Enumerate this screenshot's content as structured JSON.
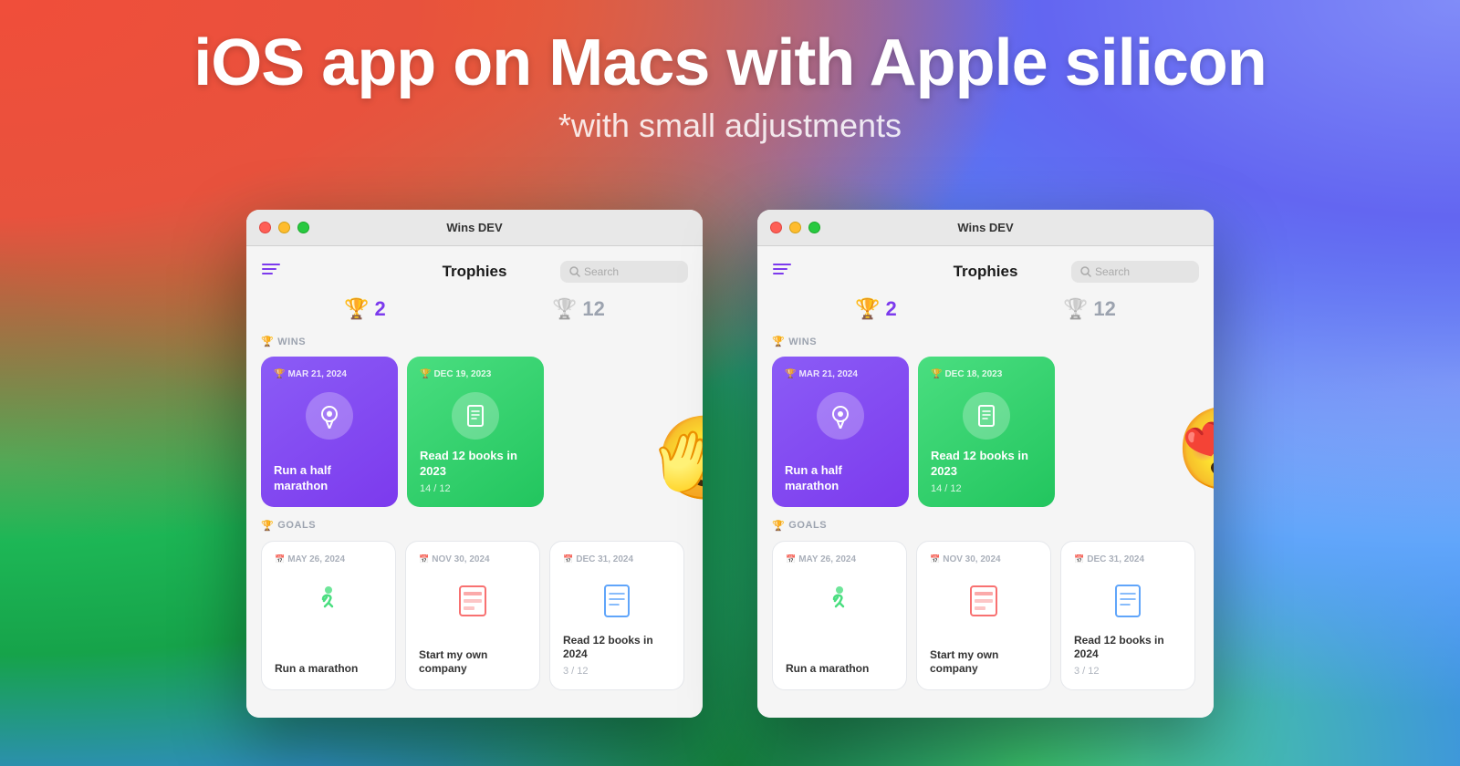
{
  "hero": {
    "title": "iOS app on Macs with Apple silicon",
    "subtitle": "*with small adjustments"
  },
  "window_left": {
    "title": "Wins DEV",
    "traffic_lights": [
      "red",
      "yellow",
      "green"
    ],
    "filter_icon": "≡",
    "section_header": "Trophies",
    "search_placeholder": "Search",
    "trophy_counts": [
      {
        "color": "purple",
        "value": "2"
      },
      {
        "color": "gray",
        "value": "12"
      }
    ],
    "wins_section": {
      "label": "WINS",
      "cards": [
        {
          "type": "purple",
          "date": "MAR 21, 2024",
          "icon": "medal",
          "name": "Run a half marathon",
          "progress": null
        },
        {
          "type": "green",
          "date": "DEC 19, 2023",
          "icon": "book",
          "name": "Read 12 books in 2023",
          "progress": "14 / 12"
        }
      ]
    },
    "goals_section": {
      "label": "GOALS",
      "cards": [
        {
          "type": "white",
          "date": "MAY 26, 2024",
          "icon": "runner",
          "icon_color": "green",
          "name": "Run a marathon",
          "progress": null
        },
        {
          "type": "white",
          "date": "NOV 30, 2024",
          "icon": "building",
          "icon_color": "red",
          "name": "Start my own company",
          "progress": null
        },
        {
          "type": "white",
          "date": "DEC 31, 2024",
          "icon": "book",
          "icon_color": "blue",
          "name": "Read 12 books in 2024",
          "progress": "3 / 12"
        }
      ]
    },
    "emoji": "🫣"
  },
  "window_right": {
    "title": "Wins DEV",
    "traffic_lights": [
      "red",
      "yellow",
      "green"
    ],
    "filter_icon": "≡",
    "section_header": "Trophies",
    "search_placeholder": "Search",
    "trophy_counts": [
      {
        "color": "purple",
        "value": "2"
      },
      {
        "color": "gray",
        "value": "12"
      }
    ],
    "wins_section": {
      "label": "WINS",
      "cards": [
        {
          "type": "purple",
          "date": "MAR 21, 2024",
          "icon": "medal",
          "name": "Run a half marathon",
          "progress": null
        },
        {
          "type": "green",
          "date": "DEC 18, 2023",
          "icon": "book",
          "name": "Read 12 books in 2023",
          "progress": "14 / 12"
        }
      ]
    },
    "goals_section": {
      "label": "GOALS",
      "cards": [
        {
          "type": "white",
          "date": "MAY 26, 2024",
          "icon": "runner",
          "icon_color": "green",
          "name": "Run a marathon",
          "progress": null
        },
        {
          "type": "white",
          "date": "NOV 30, 2024",
          "icon": "building",
          "icon_color": "red",
          "name": "Start my own company",
          "progress": null
        },
        {
          "type": "white",
          "date": "DEC 31, 2024",
          "icon": "book",
          "icon_color": "blue",
          "name": "Read 12 books in 2024",
          "progress": "3 / 12"
        }
      ]
    },
    "emoji": "😍"
  }
}
